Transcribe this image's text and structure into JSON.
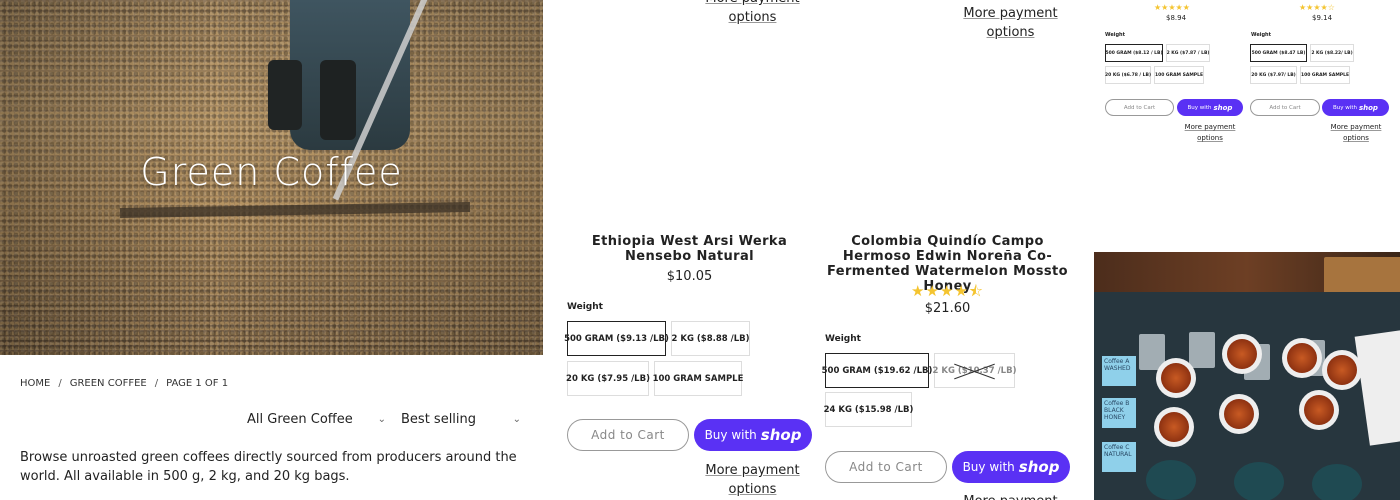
{
  "hero": {
    "title": "Green Coffee"
  },
  "breadcrumb": {
    "items": [
      "HOME",
      "GREEN COFFEE",
      "PAGE 1 OF 1"
    ],
    "separator": "/"
  },
  "filters": {
    "category": "All Green Coffee",
    "sort": "Best selling"
  },
  "intro": "Browse unroasted green coffees directly sourced from producers around the world. All available in 500 g, 2 kg, and 20 kg bags.",
  "common": {
    "weight_label": "Weight",
    "add_to_cart": "Add to Cart",
    "buy_with": "Buy with",
    "shop_word": "shop",
    "more_payment_line1": "More payment",
    "more_payment_line2": "options"
  },
  "products": [
    {
      "title": "Ethiopia West Arsi Werka Nensebo Natural",
      "price": "$10.05",
      "options": [
        "500 GRAM ($9.13 /LB)",
        "2 KG ($8.88 /LB)",
        "20 KG ($7.95 /LB)",
        "100 GRAM SAMPLE"
      ],
      "selected_option": "500 GRAM ($9.13 /LB)"
    },
    {
      "title": "Colombia Quindío Campo Hermoso Edwin Noreña Co-Fermented Watermelon Mossto Honey",
      "price": "$21.60",
      "rating": 4.5,
      "stars": "★★★★⯪",
      "options": [
        "500 GRAM ($19.62 /LB)",
        "2 KG ($10.37 /LB)",
        "24 KG ($15.98 /LB)"
      ],
      "selected_option": "500 GRAM ($19.62 /LB)",
      "unavailable_option": "2 KG ($10.37 /LB)"
    }
  ],
  "mini_products": [
    {
      "price": "$8.94",
      "stars": "★★★★★",
      "options": [
        "500 GRAM ($8.12 / LB)",
        "2 KG ($7.87 / LB)",
        "20 KG ($6.78 / LB)",
        "100 GRAM SAMPLE"
      ]
    },
    {
      "price": "$9.14",
      "stars": "★★★★☆",
      "options": [
        "500 GRAM ($8.47 LB)",
        "2 KG ($8.22/ LB)",
        "20 KG ($7.97/ LB)",
        "100 GRAM SAMPLE"
      ]
    }
  ],
  "photo": {
    "notes": [
      "Coffee A WASHED",
      "Coffee B BLACK HONEY",
      "Coffee C NATURAL"
    ]
  },
  "colors": {
    "shop_purple": "#5a31f4",
    "star_yellow": "#f4c430"
  }
}
